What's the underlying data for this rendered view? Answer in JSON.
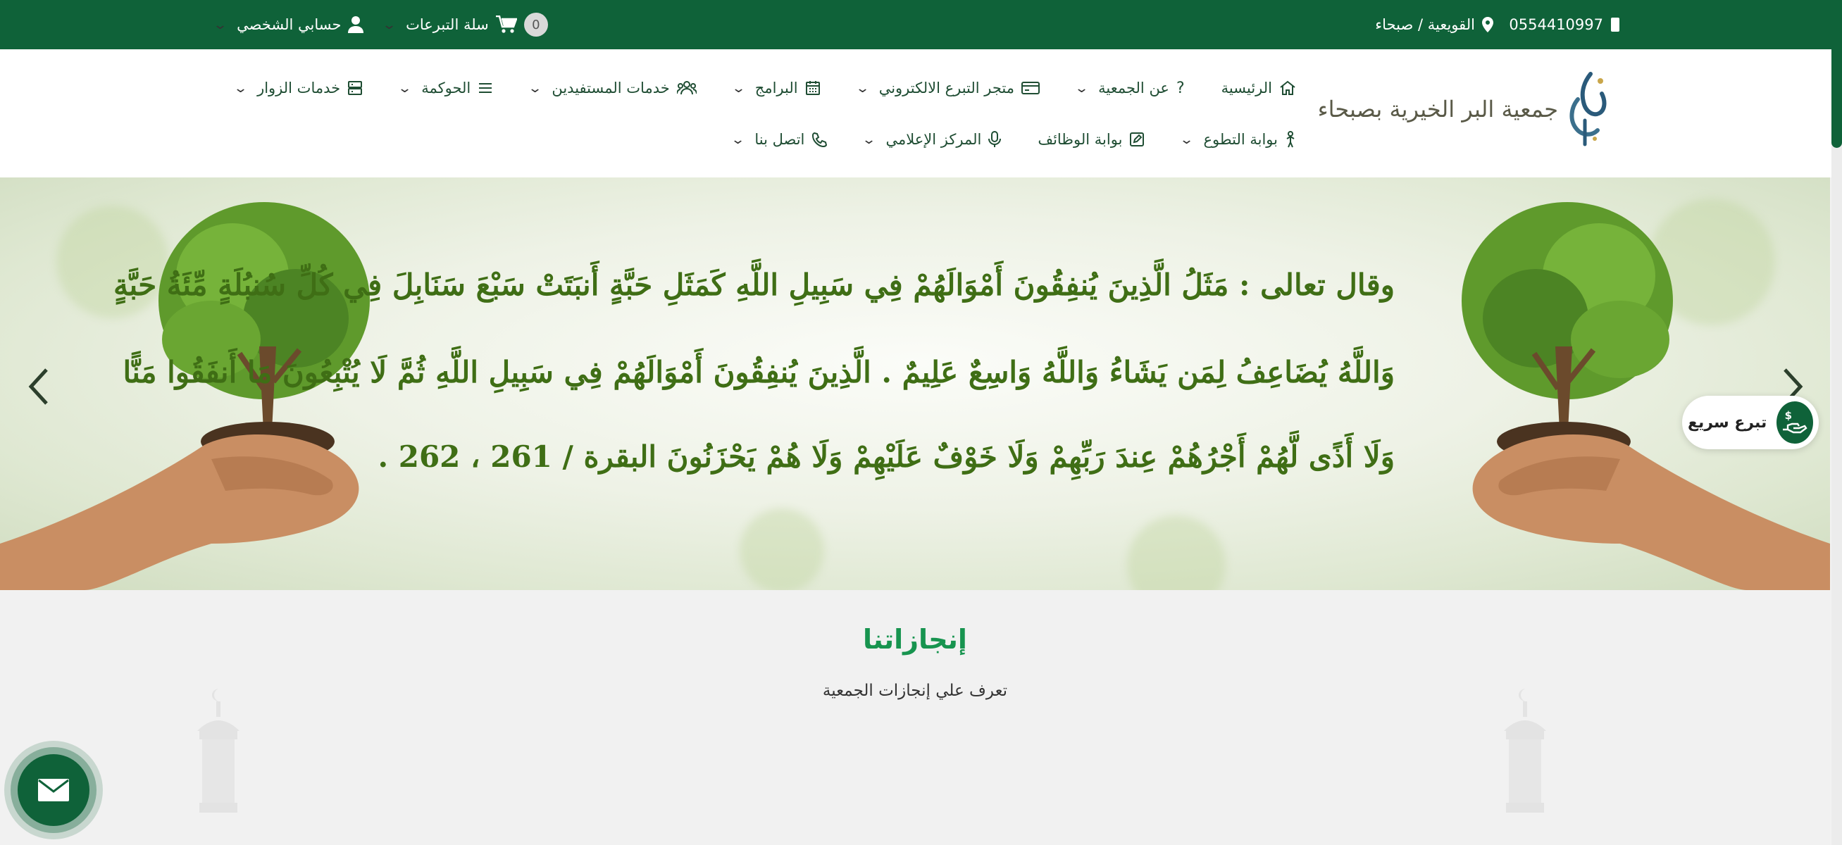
{
  "topbar": {
    "phone": "0554410997",
    "location": "القويعية / صبحاء",
    "account": "حسابي الشخصي",
    "cart_label": "سلة التبرعات",
    "cart_count": "0",
    "icons": [
      "phone-icon",
      "map-pin-icon",
      "user-icon",
      "cart-icon",
      "chevron-down-icon"
    ]
  },
  "header": {
    "logo_text": "جمعية البر الخيرية بصبحاء",
    "nav_row1": [
      {
        "label": "الرئيسية",
        "icon": "home-icon",
        "dropdown": false
      },
      {
        "label": "عن الجمعية",
        "icon": "question-icon",
        "dropdown": true
      },
      {
        "label": "متجر التبرع الالكتروني",
        "icon": "card-icon",
        "dropdown": true
      },
      {
        "label": "البرامج",
        "icon": "calendar-icon",
        "dropdown": true
      },
      {
        "label": "خدمات المستفيدين",
        "icon": "users-icon",
        "dropdown": true
      },
      {
        "label": "الحوكمة",
        "icon": "list-icon",
        "dropdown": true
      },
      {
        "label": "خدمات الزوار",
        "icon": "server-icon",
        "dropdown": true
      }
    ],
    "nav_row2": [
      {
        "label": "بوابة التطوع",
        "icon": "person-icon",
        "dropdown": true
      },
      {
        "label": "بوابة الوظائف",
        "icon": "edit-icon",
        "dropdown": false
      },
      {
        "label": "المركز الإعلامي",
        "icon": "mic-icon",
        "dropdown": true
      },
      {
        "label": "اتصل بنا",
        "icon": "phone-icon",
        "dropdown": true
      }
    ]
  },
  "hero": {
    "verse_line1": "وقال تعالى : مَثَلُ الَّذِينَ يُنفِقُونَ أَمْوَالَهُمْ فِي سَبِيلِ اللَّهِ كَمَثَلِ حَبَّةٍ أَنبَتَتْ سَبْعَ سَنَابِلَ فِي كُلِّ سُنبُلَةٍ مِّئَةُ حَبَّةٍ",
    "verse_line2": "وَاللَّهُ يُضَاعِفُ لِمَن يَشَاءُ وَاللَّهُ وَاسِعٌ عَلِيمٌ . الَّذِينَ يُنفِقُونَ أَمْوَالَهُمْ فِي سَبِيلِ اللَّهِ ثُمَّ لَا يُتْبِعُونَ مَا أَنفَقُوا مَنًّا",
    "verse_line3": "وَلَا أَذًى لَّهُمْ أَجْرُهُمْ عِندَ رَبِّهِمْ وَلَا خَوْفٌ عَلَيْهِمْ وَلَا هُمْ يَحْزَنُونَ البقرة / 261 ، 262 .",
    "colors": {
      "verse": "#3f6e15",
      "brand": "#0f6239"
    }
  },
  "quick_donate": {
    "label": "تبرع سريع",
    "icon": "donate-hand-icon"
  },
  "achievements": {
    "title": "إنجازاتنا",
    "subtitle": "تعرف علي إنجازات الجمعية"
  },
  "contact_fab": {
    "icon": "envelope-icon"
  }
}
